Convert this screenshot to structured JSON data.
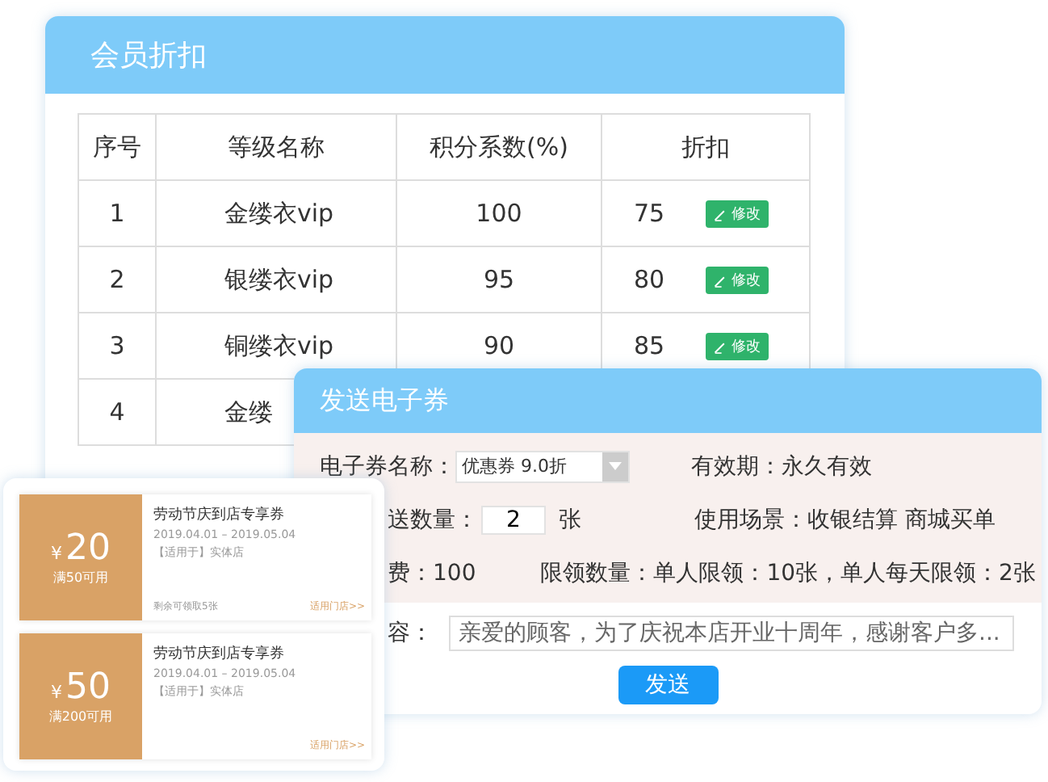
{
  "member_card": {
    "title": "会员折扣",
    "columns": [
      "序号",
      "等级名称",
      "积分系数(%)",
      "折扣"
    ],
    "rows": [
      {
        "cells": [
          "1",
          "金缕衣vip",
          "100",
          "75"
        ],
        "action": "修改"
      },
      {
        "cells": [
          "2",
          "银缕衣vip",
          "95",
          "80"
        ],
        "action": "修改"
      },
      {
        "cells": [
          "3",
          "铜缕衣vip",
          "90",
          "85"
        ],
        "action": "修改"
      },
      {
        "cells": [
          "4",
          "金缕"
        ]
      }
    ]
  },
  "send_card": {
    "title": "发送电子券",
    "name_label": "电子券名称：",
    "name_value": "优惠券 9.0折",
    "validity": "有效期：永久有效",
    "quantity_label": "送数量：",
    "quantity_value": "2",
    "quantity_unit": "张",
    "scene": "使用场景：收银结算 商城买单",
    "fee": "费：100",
    "limit": "限领数量：单人限领：10张，单人每天限领：2张",
    "content_label": "容：",
    "content_value": "亲爱的顾客，为了庆祝本店开业十周年，感谢客户多...",
    "button": "发送"
  },
  "coupons": [
    {
      "currency": "¥",
      "amount": "20",
      "condition": "满50可用",
      "title": "劳动节庆到店专享券",
      "dates": "2019.04.01 – 2019.05.04",
      "scope": "【适用于】实体店",
      "remaining": "剩余可领取5张",
      "link": "适用门店>>"
    },
    {
      "currency": "¥",
      "amount": "50",
      "condition": "满200可用",
      "title": "劳动节庆到店专享券",
      "dates": "2019.04.01 – 2019.05.04",
      "scope": "【适用于】实体店",
      "link": "适用门店>>"
    }
  ]
}
